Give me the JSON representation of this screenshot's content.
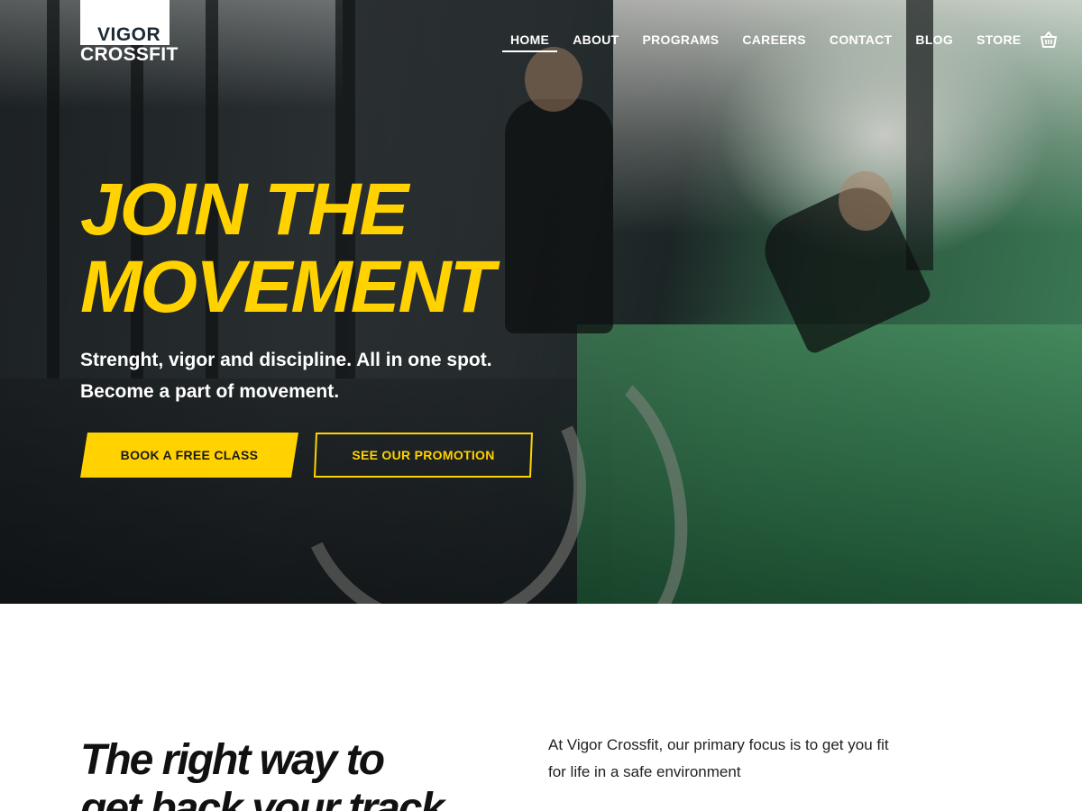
{
  "brand": {
    "logo_line1": "VIGOR",
    "logo_line2": "CROSSFIT"
  },
  "nav": {
    "items": [
      {
        "label": "HOME",
        "active": true
      },
      {
        "label": "ABOUT",
        "active": false
      },
      {
        "label": "PROGRAMS",
        "active": false
      },
      {
        "label": "CAREERS",
        "active": false
      },
      {
        "label": "CONTACT",
        "active": false
      },
      {
        "label": "BLOG",
        "active": false
      },
      {
        "label": "STORE",
        "active": false
      }
    ],
    "cart_icon": "basket-icon"
  },
  "hero": {
    "title_line1": "JOIN THE",
    "title_line2": "MOVEMENT",
    "subtitle_line1": "Strenght, vigor and discipline. All in one spot.",
    "subtitle_line2": "Become a part of movement.",
    "primary_button": "BOOK A FREE CLASS",
    "secondary_button": "SEE OUR PROMOTION"
  },
  "intro": {
    "heading_line1": "The right way to",
    "heading_line2": "get back your track",
    "text": "At Vigor Crossfit, our primary focus is to get you fit for life in a safe environment"
  },
  "colors": {
    "accent": "#ffd200",
    "logo_dark": "#1d2a33",
    "text_dark": "#111111"
  }
}
